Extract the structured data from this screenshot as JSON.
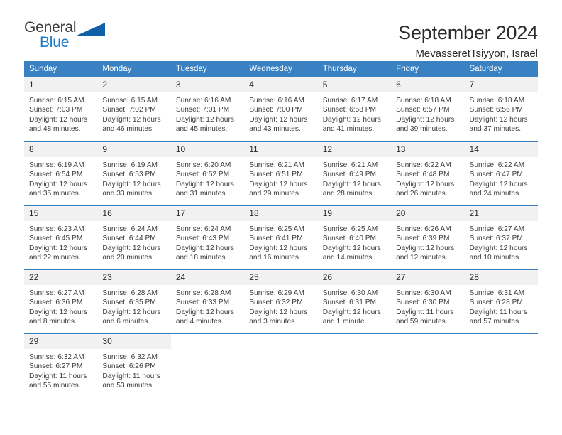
{
  "brand": {
    "line1": "General",
    "line2": "Blue",
    "flag_icon": "triangle-flag-icon",
    "accent_color": "#1f7ac4"
  },
  "header": {
    "title": "September 2024",
    "location": "MevasseretTsiyyon, Israel"
  },
  "calendar": {
    "header_bg": "#3a81c3",
    "daynum_bg": "#f1f1f1",
    "weekdays": [
      "Sunday",
      "Monday",
      "Tuesday",
      "Wednesday",
      "Thursday",
      "Friday",
      "Saturday"
    ],
    "weeks": [
      [
        {
          "day": "1",
          "sunrise": "Sunrise: 6:15 AM",
          "sunset": "Sunset: 7:03 PM",
          "daylight1": "Daylight: 12 hours",
          "daylight2": "and 48 minutes."
        },
        {
          "day": "2",
          "sunrise": "Sunrise: 6:15 AM",
          "sunset": "Sunset: 7:02 PM",
          "daylight1": "Daylight: 12 hours",
          "daylight2": "and 46 minutes."
        },
        {
          "day": "3",
          "sunrise": "Sunrise: 6:16 AM",
          "sunset": "Sunset: 7:01 PM",
          "daylight1": "Daylight: 12 hours",
          "daylight2": "and 45 minutes."
        },
        {
          "day": "4",
          "sunrise": "Sunrise: 6:16 AM",
          "sunset": "Sunset: 7:00 PM",
          "daylight1": "Daylight: 12 hours",
          "daylight2": "and 43 minutes."
        },
        {
          "day": "5",
          "sunrise": "Sunrise: 6:17 AM",
          "sunset": "Sunset: 6:58 PM",
          "daylight1": "Daylight: 12 hours",
          "daylight2": "and 41 minutes."
        },
        {
          "day": "6",
          "sunrise": "Sunrise: 6:18 AM",
          "sunset": "Sunset: 6:57 PM",
          "daylight1": "Daylight: 12 hours",
          "daylight2": "and 39 minutes."
        },
        {
          "day": "7",
          "sunrise": "Sunrise: 6:18 AM",
          "sunset": "Sunset: 6:56 PM",
          "daylight1": "Daylight: 12 hours",
          "daylight2": "and 37 minutes."
        }
      ],
      [
        {
          "day": "8",
          "sunrise": "Sunrise: 6:19 AM",
          "sunset": "Sunset: 6:54 PM",
          "daylight1": "Daylight: 12 hours",
          "daylight2": "and 35 minutes."
        },
        {
          "day": "9",
          "sunrise": "Sunrise: 6:19 AM",
          "sunset": "Sunset: 6:53 PM",
          "daylight1": "Daylight: 12 hours",
          "daylight2": "and 33 minutes."
        },
        {
          "day": "10",
          "sunrise": "Sunrise: 6:20 AM",
          "sunset": "Sunset: 6:52 PM",
          "daylight1": "Daylight: 12 hours",
          "daylight2": "and 31 minutes."
        },
        {
          "day": "11",
          "sunrise": "Sunrise: 6:21 AM",
          "sunset": "Sunset: 6:51 PM",
          "daylight1": "Daylight: 12 hours",
          "daylight2": "and 29 minutes."
        },
        {
          "day": "12",
          "sunrise": "Sunrise: 6:21 AM",
          "sunset": "Sunset: 6:49 PM",
          "daylight1": "Daylight: 12 hours",
          "daylight2": "and 28 minutes."
        },
        {
          "day": "13",
          "sunrise": "Sunrise: 6:22 AM",
          "sunset": "Sunset: 6:48 PM",
          "daylight1": "Daylight: 12 hours",
          "daylight2": "and 26 minutes."
        },
        {
          "day": "14",
          "sunrise": "Sunrise: 6:22 AM",
          "sunset": "Sunset: 6:47 PM",
          "daylight1": "Daylight: 12 hours",
          "daylight2": "and 24 minutes."
        }
      ],
      [
        {
          "day": "15",
          "sunrise": "Sunrise: 6:23 AM",
          "sunset": "Sunset: 6:45 PM",
          "daylight1": "Daylight: 12 hours",
          "daylight2": "and 22 minutes."
        },
        {
          "day": "16",
          "sunrise": "Sunrise: 6:24 AM",
          "sunset": "Sunset: 6:44 PM",
          "daylight1": "Daylight: 12 hours",
          "daylight2": "and 20 minutes."
        },
        {
          "day": "17",
          "sunrise": "Sunrise: 6:24 AM",
          "sunset": "Sunset: 6:43 PM",
          "daylight1": "Daylight: 12 hours",
          "daylight2": "and 18 minutes."
        },
        {
          "day": "18",
          "sunrise": "Sunrise: 6:25 AM",
          "sunset": "Sunset: 6:41 PM",
          "daylight1": "Daylight: 12 hours",
          "daylight2": "and 16 minutes."
        },
        {
          "day": "19",
          "sunrise": "Sunrise: 6:25 AM",
          "sunset": "Sunset: 6:40 PM",
          "daylight1": "Daylight: 12 hours",
          "daylight2": "and 14 minutes."
        },
        {
          "day": "20",
          "sunrise": "Sunrise: 6:26 AM",
          "sunset": "Sunset: 6:39 PM",
          "daylight1": "Daylight: 12 hours",
          "daylight2": "and 12 minutes."
        },
        {
          "day": "21",
          "sunrise": "Sunrise: 6:27 AM",
          "sunset": "Sunset: 6:37 PM",
          "daylight1": "Daylight: 12 hours",
          "daylight2": "and 10 minutes."
        }
      ],
      [
        {
          "day": "22",
          "sunrise": "Sunrise: 6:27 AM",
          "sunset": "Sunset: 6:36 PM",
          "daylight1": "Daylight: 12 hours",
          "daylight2": "and 8 minutes."
        },
        {
          "day": "23",
          "sunrise": "Sunrise: 6:28 AM",
          "sunset": "Sunset: 6:35 PM",
          "daylight1": "Daylight: 12 hours",
          "daylight2": "and 6 minutes."
        },
        {
          "day": "24",
          "sunrise": "Sunrise: 6:28 AM",
          "sunset": "Sunset: 6:33 PM",
          "daylight1": "Daylight: 12 hours",
          "daylight2": "and 4 minutes."
        },
        {
          "day": "25",
          "sunrise": "Sunrise: 6:29 AM",
          "sunset": "Sunset: 6:32 PM",
          "daylight1": "Daylight: 12 hours",
          "daylight2": "and 3 minutes."
        },
        {
          "day": "26",
          "sunrise": "Sunrise: 6:30 AM",
          "sunset": "Sunset: 6:31 PM",
          "daylight1": "Daylight: 12 hours",
          "daylight2": "and 1 minute."
        },
        {
          "day": "27",
          "sunrise": "Sunrise: 6:30 AM",
          "sunset": "Sunset: 6:30 PM",
          "daylight1": "Daylight: 11 hours",
          "daylight2": "and 59 minutes."
        },
        {
          "day": "28",
          "sunrise": "Sunrise: 6:31 AM",
          "sunset": "Sunset: 6:28 PM",
          "daylight1": "Daylight: 11 hours",
          "daylight2": "and 57 minutes."
        }
      ],
      [
        {
          "day": "29",
          "sunrise": "Sunrise: 6:32 AM",
          "sunset": "Sunset: 6:27 PM",
          "daylight1": "Daylight: 11 hours",
          "daylight2": "and 55 minutes."
        },
        {
          "day": "30",
          "sunrise": "Sunrise: 6:32 AM",
          "sunset": "Sunset: 6:26 PM",
          "daylight1": "Daylight: 11 hours",
          "daylight2": "and 53 minutes."
        },
        {
          "day": "",
          "sunrise": "",
          "sunset": "",
          "daylight1": "",
          "daylight2": ""
        },
        {
          "day": "",
          "sunrise": "",
          "sunset": "",
          "daylight1": "",
          "daylight2": ""
        },
        {
          "day": "",
          "sunrise": "",
          "sunset": "",
          "daylight1": "",
          "daylight2": ""
        },
        {
          "day": "",
          "sunrise": "",
          "sunset": "",
          "daylight1": "",
          "daylight2": ""
        },
        {
          "day": "",
          "sunrise": "",
          "sunset": "",
          "daylight1": "",
          "daylight2": ""
        }
      ]
    ]
  }
}
